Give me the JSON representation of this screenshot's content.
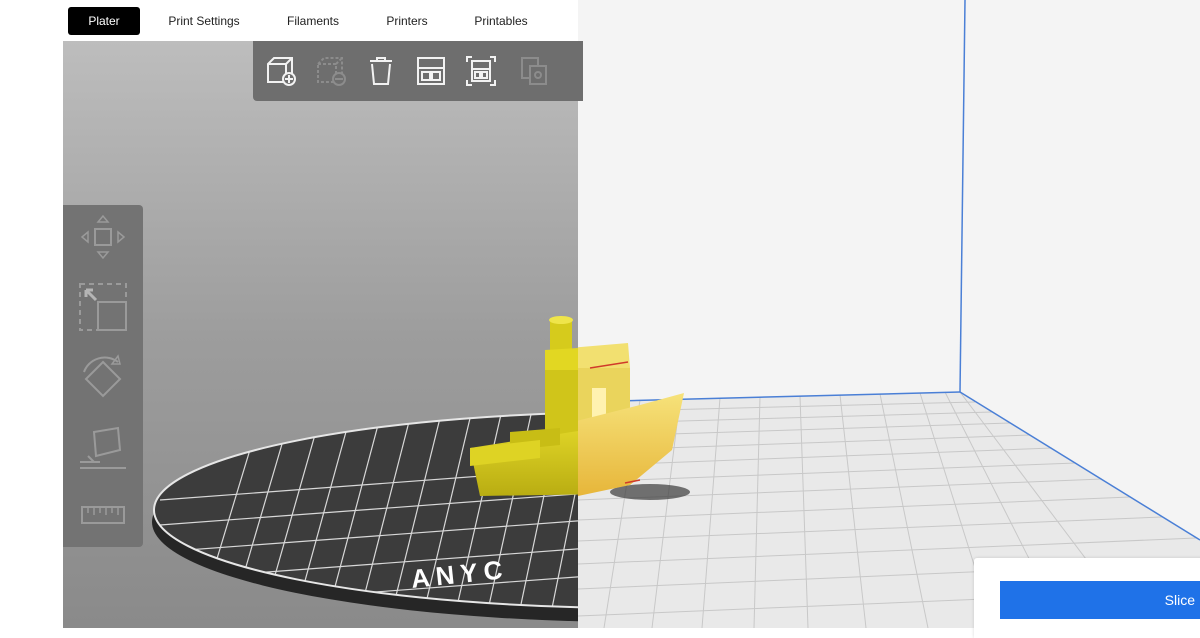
{
  "tabs": [
    {
      "label": "Plater",
      "active": true
    },
    {
      "label": "Print Settings",
      "active": false
    },
    {
      "label": "Filaments",
      "active": false
    },
    {
      "label": "Printers",
      "active": false
    },
    {
      "label": "Printables",
      "active": false
    }
  ],
  "top_toolbar": {
    "icons": [
      "add-object-icon",
      "remove-object-icon",
      "delete-icon",
      "arrange-icon",
      "arrange-selection-icon",
      "copy-icon"
    ]
  },
  "side_toolbar": {
    "icons": [
      "move-icon",
      "scale-icon",
      "rotate-icon",
      "place-on-face-icon",
      "measure-icon"
    ]
  },
  "bed": {
    "brand_text": "ANYC"
  },
  "slice": {
    "label": "Slice"
  },
  "colors": {
    "accent": "#1f72e8",
    "model": "#e3d92a",
    "model_right": "#f1dc5c",
    "bed_dark": "#3a3a3a"
  }
}
